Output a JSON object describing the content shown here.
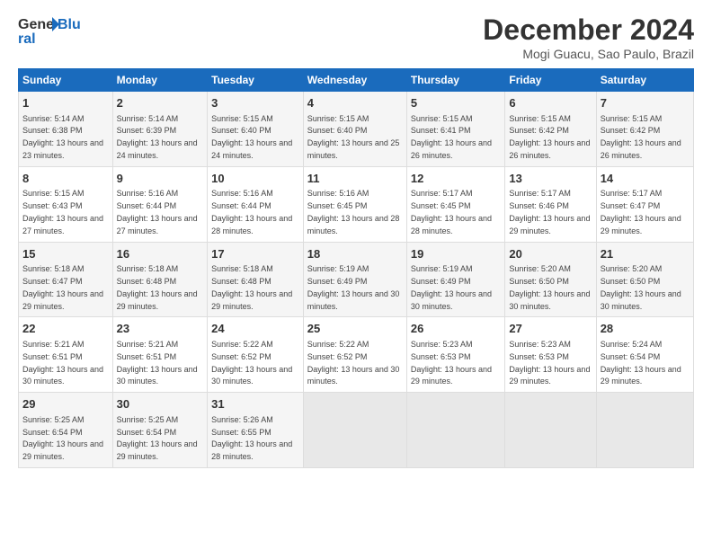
{
  "logo": {
    "line1": "General",
    "line2": "Blue"
  },
  "title": "December 2024",
  "location": "Mogi Guacu, Sao Paulo, Brazil",
  "weekdays": [
    "Sunday",
    "Monday",
    "Tuesday",
    "Wednesday",
    "Thursday",
    "Friday",
    "Saturday"
  ],
  "weeks": [
    [
      {
        "day": "1",
        "sunrise": "5:14 AM",
        "sunset": "6:38 PM",
        "daylight": "13 hours and 23 minutes."
      },
      {
        "day": "2",
        "sunrise": "5:14 AM",
        "sunset": "6:39 PM",
        "daylight": "13 hours and 24 minutes."
      },
      {
        "day": "3",
        "sunrise": "5:15 AM",
        "sunset": "6:40 PM",
        "daylight": "13 hours and 24 minutes."
      },
      {
        "day": "4",
        "sunrise": "5:15 AM",
        "sunset": "6:40 PM",
        "daylight": "13 hours and 25 minutes."
      },
      {
        "day": "5",
        "sunrise": "5:15 AM",
        "sunset": "6:41 PM",
        "daylight": "13 hours and 26 minutes."
      },
      {
        "day": "6",
        "sunrise": "5:15 AM",
        "sunset": "6:42 PM",
        "daylight": "13 hours and 26 minutes."
      },
      {
        "day": "7",
        "sunrise": "5:15 AM",
        "sunset": "6:42 PM",
        "daylight": "13 hours and 26 minutes."
      }
    ],
    [
      {
        "day": "8",
        "sunrise": "5:15 AM",
        "sunset": "6:43 PM",
        "daylight": "13 hours and 27 minutes."
      },
      {
        "day": "9",
        "sunrise": "5:16 AM",
        "sunset": "6:44 PM",
        "daylight": "13 hours and 27 minutes."
      },
      {
        "day": "10",
        "sunrise": "5:16 AM",
        "sunset": "6:44 PM",
        "daylight": "13 hours and 28 minutes."
      },
      {
        "day": "11",
        "sunrise": "5:16 AM",
        "sunset": "6:45 PM",
        "daylight": "13 hours and 28 minutes."
      },
      {
        "day": "12",
        "sunrise": "5:17 AM",
        "sunset": "6:45 PM",
        "daylight": "13 hours and 28 minutes."
      },
      {
        "day": "13",
        "sunrise": "5:17 AM",
        "sunset": "6:46 PM",
        "daylight": "13 hours and 29 minutes."
      },
      {
        "day": "14",
        "sunrise": "5:17 AM",
        "sunset": "6:47 PM",
        "daylight": "13 hours and 29 minutes."
      }
    ],
    [
      {
        "day": "15",
        "sunrise": "5:18 AM",
        "sunset": "6:47 PM",
        "daylight": "13 hours and 29 minutes."
      },
      {
        "day": "16",
        "sunrise": "5:18 AM",
        "sunset": "6:48 PM",
        "daylight": "13 hours and 29 minutes."
      },
      {
        "day": "17",
        "sunrise": "5:18 AM",
        "sunset": "6:48 PM",
        "daylight": "13 hours and 29 minutes."
      },
      {
        "day": "18",
        "sunrise": "5:19 AM",
        "sunset": "6:49 PM",
        "daylight": "13 hours and 30 minutes."
      },
      {
        "day": "19",
        "sunrise": "5:19 AM",
        "sunset": "6:49 PM",
        "daylight": "13 hours and 30 minutes."
      },
      {
        "day": "20",
        "sunrise": "5:20 AM",
        "sunset": "6:50 PM",
        "daylight": "13 hours and 30 minutes."
      },
      {
        "day": "21",
        "sunrise": "5:20 AM",
        "sunset": "6:50 PM",
        "daylight": "13 hours and 30 minutes."
      }
    ],
    [
      {
        "day": "22",
        "sunrise": "5:21 AM",
        "sunset": "6:51 PM",
        "daylight": "13 hours and 30 minutes."
      },
      {
        "day": "23",
        "sunrise": "5:21 AM",
        "sunset": "6:51 PM",
        "daylight": "13 hours and 30 minutes."
      },
      {
        "day": "24",
        "sunrise": "5:22 AM",
        "sunset": "6:52 PM",
        "daylight": "13 hours and 30 minutes."
      },
      {
        "day": "25",
        "sunrise": "5:22 AM",
        "sunset": "6:52 PM",
        "daylight": "13 hours and 30 minutes."
      },
      {
        "day": "26",
        "sunrise": "5:23 AM",
        "sunset": "6:53 PM",
        "daylight": "13 hours and 29 minutes."
      },
      {
        "day": "27",
        "sunrise": "5:23 AM",
        "sunset": "6:53 PM",
        "daylight": "13 hours and 29 minutes."
      },
      {
        "day": "28",
        "sunrise": "5:24 AM",
        "sunset": "6:54 PM",
        "daylight": "13 hours and 29 minutes."
      }
    ],
    [
      {
        "day": "29",
        "sunrise": "5:25 AM",
        "sunset": "6:54 PM",
        "daylight": "13 hours and 29 minutes."
      },
      {
        "day": "30",
        "sunrise": "5:25 AM",
        "sunset": "6:54 PM",
        "daylight": "13 hours and 29 minutes."
      },
      {
        "day": "31",
        "sunrise": "5:26 AM",
        "sunset": "6:55 PM",
        "daylight": "13 hours and 28 minutes."
      },
      null,
      null,
      null,
      null
    ]
  ]
}
